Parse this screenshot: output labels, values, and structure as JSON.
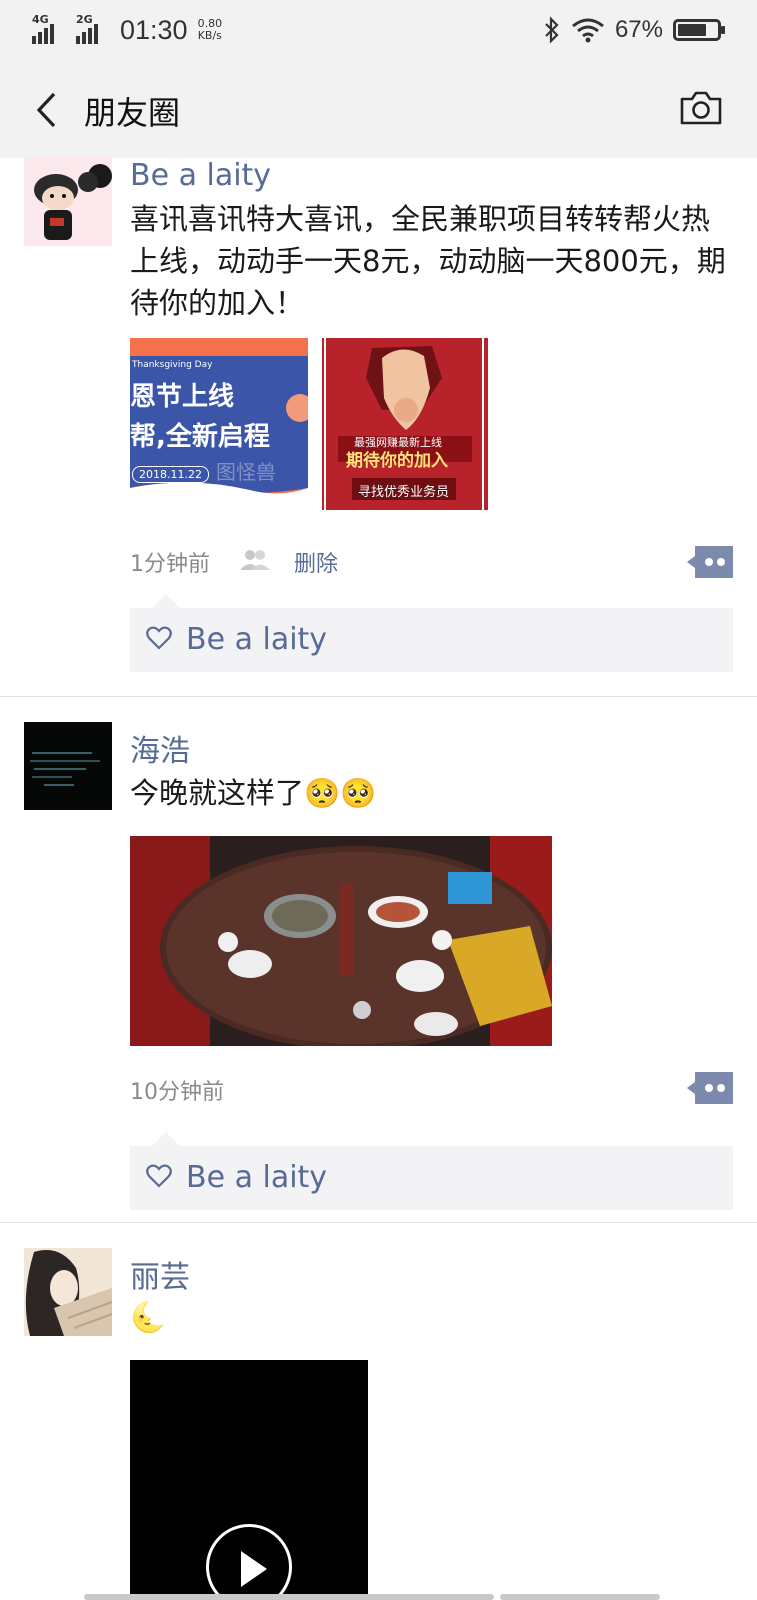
{
  "status_bar": {
    "network1": "4G",
    "network2": "2G",
    "time": "01:30",
    "speed_value": "0.80",
    "speed_unit": "KB/s",
    "battery_percent": "67%",
    "battery_level": 0.67
  },
  "nav": {
    "title": "朋友圈",
    "back_icon": "chevron-left-icon",
    "camera_icon": "camera-icon"
  },
  "posts": [
    {
      "user": "Be a laity",
      "text": "喜讯喜讯特大喜讯，全民兼职项目转转帮火热上线，动动手一天8元，动动脑一天800元，期待你的加入！",
      "images": [
        {
          "line1": "Thanksgiving Day",
          "line2": "恩节上线",
          "line3": "帮,全新启程",
          "line4": "2018.11.22",
          "watermark": "图怪兽"
        },
        {
          "line1": "最强网赚最新上线",
          "line2": "期待你的加入",
          "line3": "寻找优秀业务员"
        }
      ],
      "time": "1分钟前",
      "delete": "删除",
      "likes": [
        "Be a laity"
      ]
    },
    {
      "user": "海浩",
      "text": "今晚就这样了",
      "emoji": "🥺🥺",
      "time": "10分钟前",
      "likes": [
        "Be a laity"
      ]
    },
    {
      "user": "丽芸",
      "emoji": "🌜"
    }
  ],
  "colors": {
    "name_blue": "#576b95",
    "bar_bg": "#f2f2f2",
    "likes_bg": "#f3f3f5"
  }
}
